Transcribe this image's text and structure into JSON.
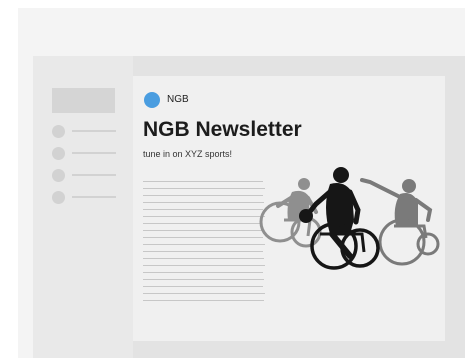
{
  "newsletter": {
    "brand": "NGB",
    "title": "NGB Newsletter",
    "tagline": "tune in on XYZ sports!"
  },
  "colors": {
    "accent": "#4a9de0",
    "ink": "#1c1c1c",
    "frame": "#e3e3e3",
    "sidebar": "#e9e9e9",
    "content": "#f0f0f0"
  },
  "icons": {
    "brand_logo": "blue-circle-logo",
    "hero": "wheelchair-basketball-players"
  }
}
